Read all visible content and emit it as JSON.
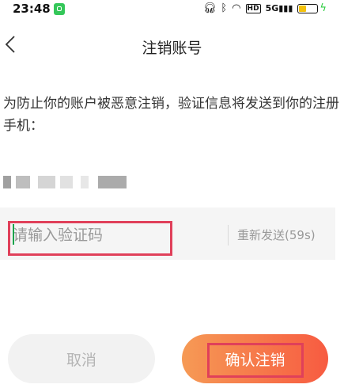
{
  "status_bar": {
    "time": "23:48",
    "network_label": "HD",
    "signal_label": "5G",
    "battery_level": 0.45,
    "battery_color": "#f4c20d",
    "icons": [
      "app-icon",
      "headphones-icon",
      "bluetooth-icon",
      "wifi-icon",
      "signal-icon",
      "battery-icon",
      "charging-icon"
    ]
  },
  "nav": {
    "title": "注销账号",
    "back_icon": "chevron-left-icon"
  },
  "info_text": "为防止你的账户被恶意注销，验证信息将发送到你的注册手机：",
  "phone_masked": "",
  "verification": {
    "placeholder": "请输入验证码",
    "value": "",
    "resend_label": "重新发送(59s)"
  },
  "buttons": {
    "cancel_label": "取消",
    "confirm_label": "确认注销"
  },
  "colors": {
    "accent_start": "#f69a55",
    "accent_end": "#f75b41",
    "highlight": "#e0405a",
    "cursor": "#1aa34a"
  }
}
